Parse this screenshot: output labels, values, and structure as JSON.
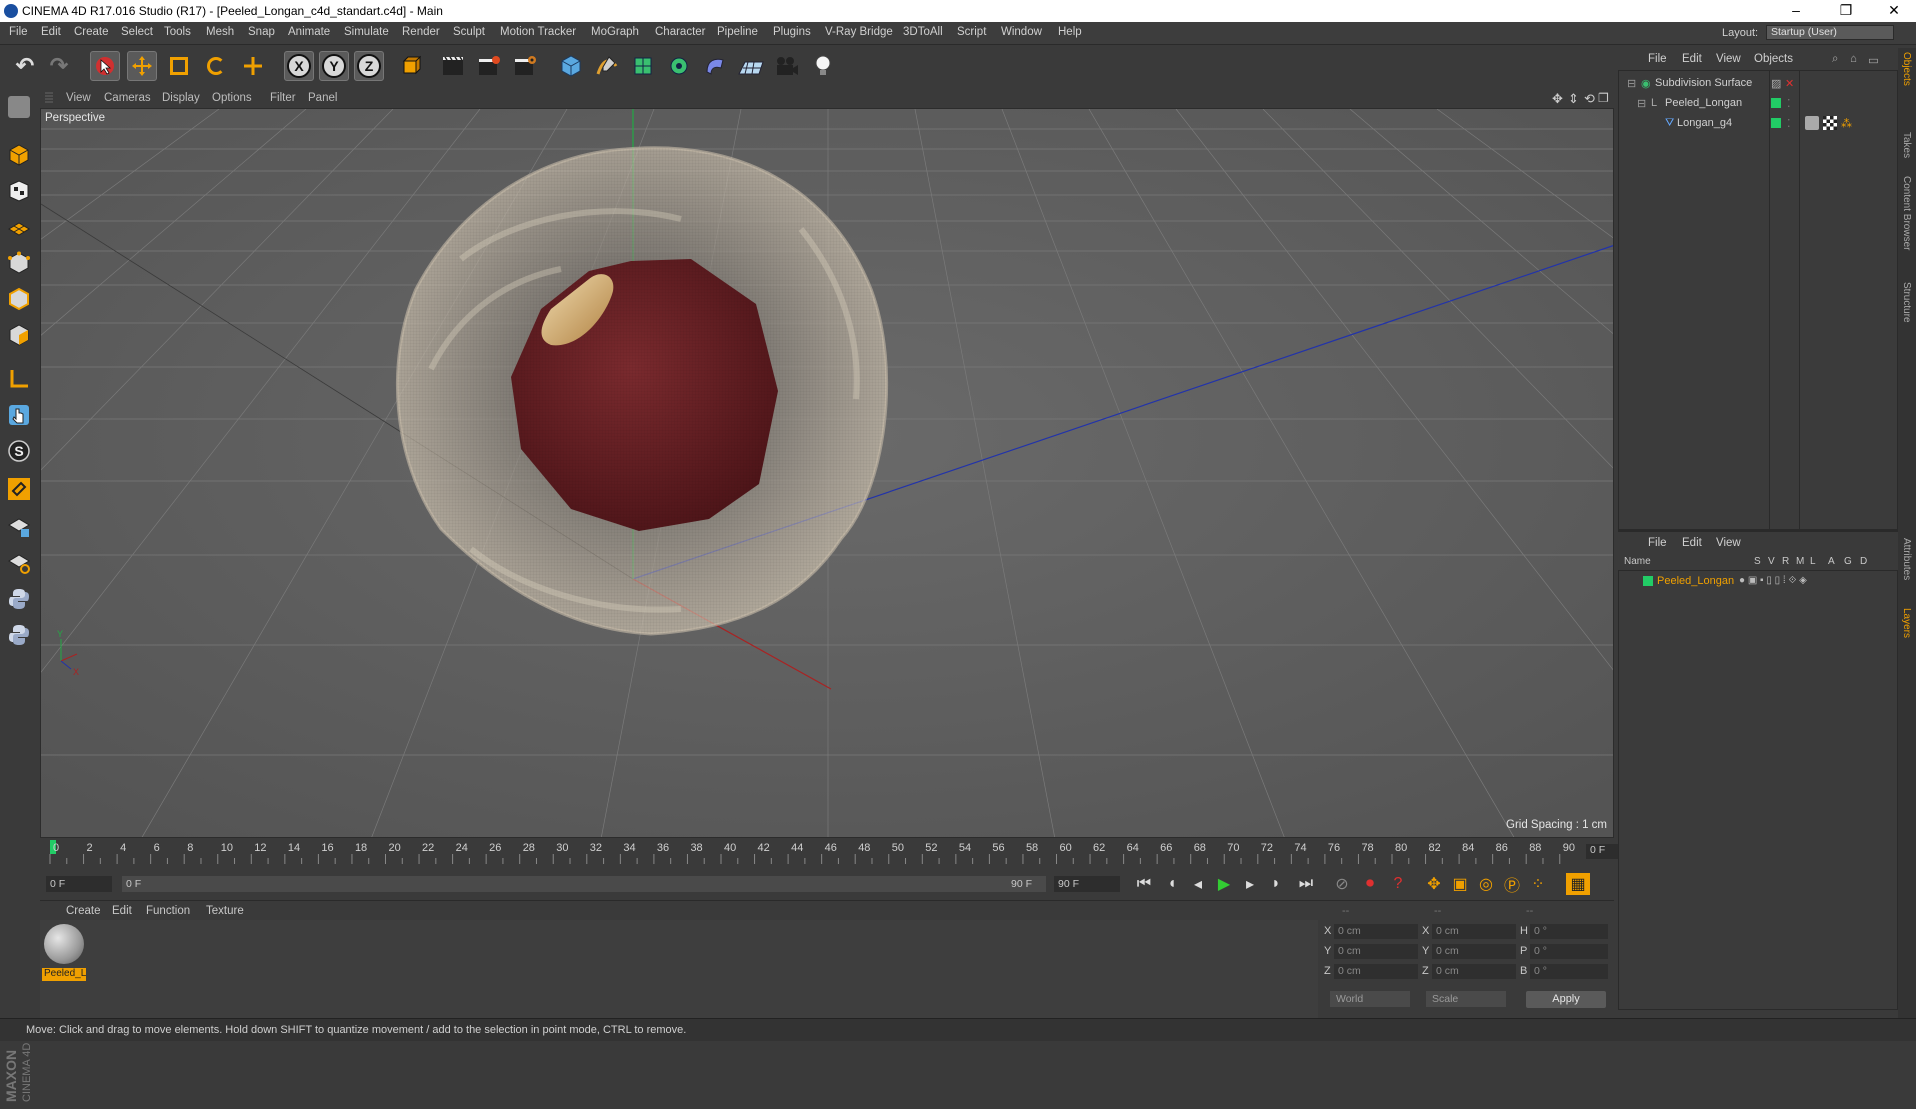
{
  "window": {
    "title": "CINEMA 4D R17.016 Studio (R17) - [Peeled_Longan_c4d_standart.c4d] - Main",
    "controls": [
      "–",
      "❐",
      "✕"
    ]
  },
  "menubar": {
    "items": [
      "File",
      "Edit",
      "Create",
      "Select",
      "Tools",
      "Mesh",
      "Snap",
      "Animate",
      "Simulate",
      "Render",
      "Sculpt",
      "Motion Tracker",
      "MoGraph",
      "Character",
      "Pipeline",
      "Plugins",
      "V-Ray Bridge",
      "3DToAll",
      "Script",
      "Window",
      "Help"
    ],
    "layout_label": "Layout:",
    "layout_value": "Startup (User)"
  },
  "toolbar": {
    "buttons": [
      "undo-icon",
      "redo-icon",
      "select-arrow-icon",
      "move-icon",
      "scale-icon",
      "rotate-icon",
      "transform-icon",
      "x-axis",
      "y-axis",
      "z-axis",
      "world-coords-icon",
      "render-view-icon",
      "render-picture-queue-icon",
      "render-settings-icon",
      "cube-primitive-icon",
      "spline-pen-icon",
      "subdivision-icon",
      "mograph-cloner-icon",
      "deformer-icon",
      "floor-icon",
      "camera-icon",
      "light-icon"
    ],
    "axis_labels": [
      "X",
      "Y",
      "Z"
    ]
  },
  "viewport": {
    "menu": [
      "View",
      "Cameras",
      "Display",
      "Options",
      "Filter",
      "Panel"
    ],
    "label": "Perspective",
    "grid_spacing": "Grid Spacing : 1 cm"
  },
  "timeline": {
    "ticks": [
      "0",
      "2",
      "4",
      "6",
      "8",
      "10",
      "12",
      "14",
      "16",
      "18",
      "20",
      "22",
      "24",
      "26",
      "28",
      "30",
      "32",
      "34",
      "36",
      "38",
      "40",
      "42",
      "44",
      "46",
      "48",
      "50",
      "52",
      "54",
      "56",
      "58",
      "60",
      "62",
      "64",
      "66",
      "68",
      "70",
      "72",
      "74",
      "76",
      "78",
      "80",
      "82",
      "84",
      "86",
      "88",
      "90"
    ],
    "current_frame": "0 F"
  },
  "transport": {
    "start_frame": "0 F",
    "range_start": "0 F",
    "range_end": "90 F",
    "end_frame": "90 F"
  },
  "material_manager": {
    "menu": [
      "Create",
      "Edit",
      "Function",
      "Texture"
    ],
    "material_name": "Peeled_L"
  },
  "coordinates": {
    "headers": [
      "--",
      "--",
      "--"
    ],
    "rows": [
      {
        "axis": "X",
        "pos": "0 cm",
        "size_axis": "X",
        "size": "0 cm",
        "rot_axis": "H",
        "rot": "0 °"
      },
      {
        "axis": "Y",
        "pos": "0 cm",
        "size_axis": "Y",
        "size": "0 cm",
        "rot_axis": "P",
        "rot": "0 °"
      },
      {
        "axis": "Z",
        "pos": "0 cm",
        "size_axis": "Z",
        "size": "0 cm",
        "rot_axis": "B",
        "rot": "0 °"
      }
    ],
    "space_mode": "World",
    "size_mode": "Scale",
    "apply": "Apply"
  },
  "object_manager": {
    "menu": [
      "File",
      "Edit",
      "View",
      "Objects"
    ],
    "objects": [
      {
        "name": "Subdivision Surface"
      },
      {
        "name": "Peeled_Longan"
      },
      {
        "name": "Longan_g4"
      }
    ]
  },
  "layer_manager": {
    "menu": [
      "File",
      "Edit",
      "View"
    ],
    "header": {
      "name": "Name",
      "flags": [
        "S",
        "V",
        "R",
        "M",
        "L",
        "A",
        "G",
        "D"
      ]
    },
    "layers": [
      {
        "name": "Peeled_Longan"
      }
    ]
  },
  "side_tabs": [
    "Objects",
    "Takes",
    "Content Browser",
    "Structure",
    "Attributes",
    "Layers"
  ],
  "status": "Move: Click and drag to move elements. Hold down SHIFT to quantize movement / add to the selection in point mode, CTRL to remove.",
  "colors": {
    "accent": "#f0a000",
    "layer_green": "#22cc66",
    "flesh": "#6e2428"
  }
}
